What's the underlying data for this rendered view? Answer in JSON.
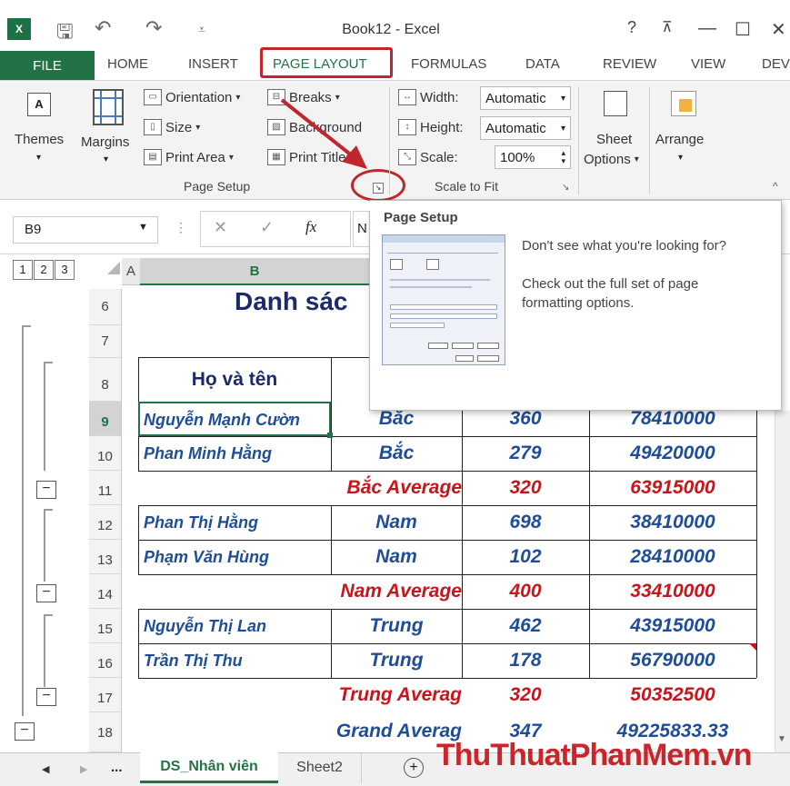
{
  "window": {
    "title": "Book12 - Excel",
    "help": "?",
    "ribbon_toggle": "⊼",
    "minimize": "—",
    "maximize": "☐",
    "close": "✕"
  },
  "tabs": [
    {
      "label": "FILE"
    },
    {
      "label": "HOME"
    },
    {
      "label": "INSERT"
    },
    {
      "label": "PAGE LAYOUT"
    },
    {
      "label": "FORMULAS"
    },
    {
      "label": "DATA"
    },
    {
      "label": "REVIEW"
    },
    {
      "label": "VIEW"
    },
    {
      "label": "DEV"
    }
  ],
  "ribbon": {
    "themes": "Themes",
    "margins": "Margins",
    "orientation": "Orientation",
    "size": "Size",
    "print_area": "Print Area",
    "breaks": "Breaks",
    "background": "Background",
    "print_titles": "Print Titles",
    "page_setup_group": "Page Setup",
    "width_label": "Width:",
    "width_value": "Automatic",
    "height_label": "Height:",
    "height_value": "Automatic",
    "scale_label": "Scale:",
    "scale_value": "100%",
    "scale_group": "Scale to Fit",
    "sheet_options_1": "Sheet",
    "sheet_options_2": "Options",
    "arrange": "Arrange"
  },
  "formula_bar": {
    "name_box": "B9",
    "cancel": "✕",
    "enter": "✓",
    "fx": "fx",
    "content_partial": "N"
  },
  "outline_levels": [
    "1",
    "2",
    "3"
  ],
  "columns": {
    "a": "A",
    "b": "B"
  },
  "sheet": {
    "title_partial": "Danh sác",
    "header_name": "Họ và tên",
    "rows": [
      {
        "num": "6"
      },
      {
        "num": "7"
      },
      {
        "num": "8"
      },
      {
        "num": "9",
        "name": "Nguyễn  Mạnh Cườn",
        "region": "Bắc",
        "qty": "360",
        "amount": "78410000"
      },
      {
        "num": "10",
        "name": "Phan  Minh Hằng",
        "region": "Bắc",
        "qty": "279",
        "amount": "49420000"
      },
      {
        "num": "11",
        "summary": "Bắc Average",
        "qty": "320",
        "amount": "63915000"
      },
      {
        "num": "12",
        "name": "Phan  Thị Hằng",
        "region": "Nam",
        "qty": "698",
        "amount": "38410000"
      },
      {
        "num": "13",
        "name": "Phạm  Văn Hùng",
        "region": "Nam",
        "qty": "102",
        "amount": "28410000"
      },
      {
        "num": "14",
        "summary": "Nam Average",
        "qty": "400",
        "amount": "33410000"
      },
      {
        "num": "15",
        "name": "Nguyễn  Thị Lan",
        "region": "Trung",
        "qty": "462",
        "amount": "43915000"
      },
      {
        "num": "16",
        "name": "Trần  Thị Thu",
        "region": "Trung",
        "qty": "178",
        "amount": "56790000"
      },
      {
        "num": "17",
        "summary": "Trung Averag",
        "qty": "320",
        "amount": "50352500"
      },
      {
        "num": "18",
        "summary": "Grand Averag",
        "qty": "347",
        "amount": "49225833.33"
      }
    ]
  },
  "popup": {
    "title": "Page Setup",
    "line1": "Don't see what you're looking for?",
    "line2": "Check out the full set of page formatting options."
  },
  "sheet_tabs": {
    "ellipsis": "...",
    "active": "DS_Nhân viên",
    "other": "Sheet2",
    "add": "+"
  },
  "watermark": "ThuThuatPhanMem.vn",
  "colors": {
    "excel_green": "#217346",
    "annotation_red": "#c0262c",
    "name_blue": "#1f4e96",
    "summary_red": "#c8141b"
  }
}
